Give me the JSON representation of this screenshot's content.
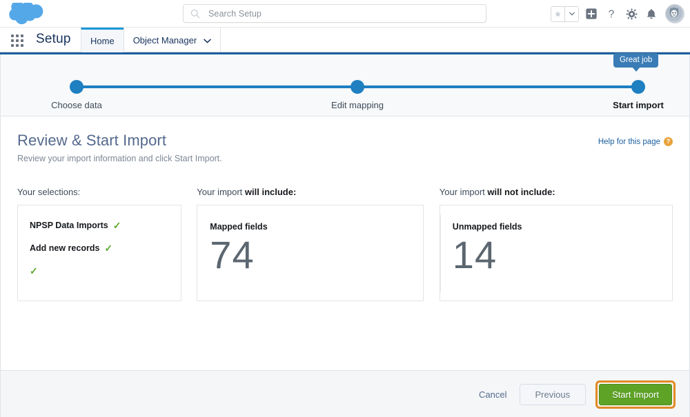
{
  "header": {
    "logo_icon": "salesforce-cloud-icon",
    "search": {
      "icon": "search-icon",
      "placeholder": "Search Setup",
      "value": ""
    },
    "actions": {
      "favorites_icon": "star-icon",
      "favorites_caret_icon": "chevron-down-icon",
      "add_icon": "plus-square-icon",
      "help_icon": "question-mark-icon",
      "setup_icon": "gear-icon",
      "notifications_icon": "bell-icon",
      "avatar_icon": "user-avatar-icon"
    }
  },
  "setup_bar": {
    "app_launcher_icon": "app-launcher-grid-icon",
    "title": "Setup",
    "tabs": [
      {
        "label": "Home",
        "active": true
      },
      {
        "label": "Object Manager",
        "active": false,
        "caret_icon": "chevron-down-icon"
      }
    ]
  },
  "tracker": {
    "tooltip": "Great job",
    "steps": [
      {
        "label": "Choose data",
        "current": false
      },
      {
        "label": "Edit mapping",
        "current": false
      },
      {
        "label": "Start import",
        "current": true
      }
    ],
    "line_color": "#1e7fc1",
    "tooltip_color": "#3a7cb5"
  },
  "main": {
    "title": "Review & Start Import",
    "subtitle": "Review your import information and click Start Import.",
    "help_link": {
      "label": "Help for this page",
      "badge": "?",
      "badge_color": "#e8a33d"
    },
    "columns": {
      "selections": {
        "heading_regular": "Your selections:",
        "heading_bold": "",
        "items": [
          {
            "label": "NPSP Data Imports",
            "check": "✓"
          },
          {
            "label": "Add new records",
            "check": "✓"
          },
          {
            "label": "",
            "check": "✓"
          }
        ],
        "check_color": "#5aa72b"
      },
      "will_include": {
        "heading_regular": "Your import ",
        "heading_bold": "will include:",
        "stat_label": "Mapped fields",
        "stat_value": "74"
      },
      "will_not_include": {
        "heading_regular": "Your import ",
        "heading_bold": "will not include:",
        "stat_label": "Unmapped fields",
        "stat_value": "14"
      }
    }
  },
  "footer": {
    "cancel_label": "Cancel",
    "previous_label": "Previous",
    "start_import_label": "Start Import",
    "start_import_color": "#5ea226",
    "highlight_color": "#e08a27"
  }
}
